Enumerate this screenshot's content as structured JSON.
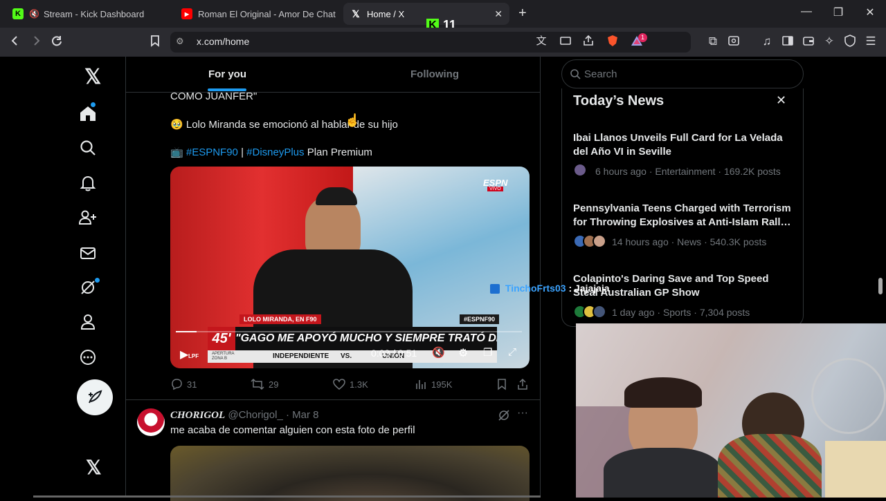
{
  "browser": {
    "tabs": [
      {
        "label": "Stream - Kick Dashboard"
      },
      {
        "label": "Roman El Original - Amor De Chat - Y"
      },
      {
        "label": "Home / X"
      }
    ],
    "url": "x.com/home",
    "overlay_count": "11",
    "notification_badge": "1"
  },
  "feed": {
    "tabs": [
      "For you",
      "Following"
    ],
    "tweet1": {
      "line1": "COMO JUANFER\"",
      "line2_emoji": "🥹",
      "line2": "Lolo Miranda se emocionó al hablar de su hijo",
      "line3_emoji": "📺",
      "hashtag1": "#ESPNF90",
      "separator": "|",
      "hashtag2": "#DisneyPlus",
      "line3_tail": "Plan Premium",
      "video": {
        "channel": "ESPN",
        "channel_sub": "VIVO",
        "lower_third_name": "LOLO MIRANDA, EN F90",
        "lower_third_tag": "#ESPNF90",
        "minute": "45'",
        "headline": "\"GAGO ME APOYÓ MUCHO Y SIEMPRE TRATÓ DE CUIDARME\"",
        "ticker_left": "APERTURA ZONA B",
        "ticker_team1": "INDEPENDIENTE",
        "ticker_vs": "VS.",
        "ticker_team2": "UNIÓN",
        "league": "LPF",
        "time": "0:03 / 0:51",
        "progress": 0.06
      },
      "stats": {
        "replies": "31",
        "reposts": "29",
        "likes": "1.3K",
        "views": "195K"
      }
    },
    "tweet2": {
      "author": "CHORIGOL",
      "handle": "@Chorigol_",
      "date": "· Mar 8",
      "text": "me acaba de comentar alguien con esta foto de perfil"
    }
  },
  "right": {
    "search_placeholder": "Search",
    "news_header": "Today’s News",
    "news": [
      {
        "title": "Ibai Llanos Unveils Full Card for La Velada del Año VI in Seville",
        "meta": "6 hours ago · Entertainment · 169.2K posts"
      },
      {
        "title": "Pennsylvania Teens Charged with Terrorism for Throwing Explosives at Anti-Islam Rall…",
        "meta": "14 hours ago · News · 540.3K posts"
      },
      {
        "title": "Colapinto's Daring Save and Top Speed Steal Australian GP Show",
        "meta": "1 day ago · Sports · 7,304 posts"
      }
    ]
  },
  "chat_overlay": {
    "user": "TinchoFrts03",
    "message": ": Jajajaja"
  },
  "colors": {
    "accent": "#1d9bf0",
    "background": "#000000",
    "kick_green": "#53fc18"
  }
}
